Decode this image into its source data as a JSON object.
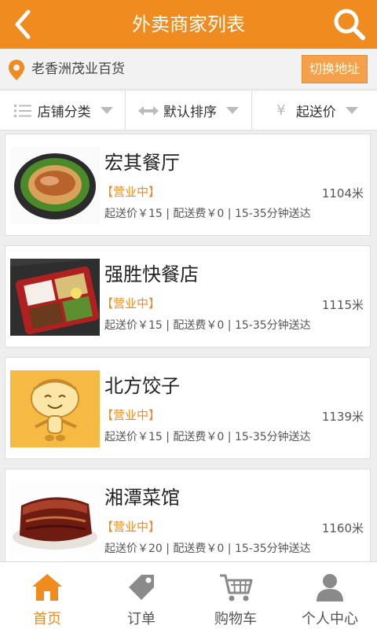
{
  "header": {
    "title": "外卖商家列表"
  },
  "address": {
    "text": "老香洲茂业百货",
    "switch_label": "切换地址"
  },
  "filters": [
    {
      "label": "店铺分类"
    },
    {
      "label": "默认排序"
    },
    {
      "label": "起送价"
    }
  ],
  "shops": [
    {
      "name": "宏其餐厅",
      "status": "【营业中】",
      "distance": "1104米",
      "meta": "起送价￥15 |  配送费￥0 | 15-35分钟送达"
    },
    {
      "name": "强胜快餐店",
      "status": "【营业中】",
      "distance": "1115米",
      "meta": "起送价￥15 |  配送费￥0 | 15-35分钟送达"
    },
    {
      "name": "北方饺子",
      "status": "【营业中】",
      "distance": "1139米",
      "meta": "起送价￥15 |  配送费￥0 | 15-35分钟送达"
    },
    {
      "name": "湘潭菜馆",
      "status": "【营业中】",
      "distance": "1160米",
      "meta": "起送价￥20 |  配送费￥0 | 15-35分钟送达"
    }
  ],
  "tabs": [
    {
      "label": "首页",
      "icon": "home-icon",
      "active": true
    },
    {
      "label": "订单",
      "icon": "tag-icon",
      "active": false
    },
    {
      "label": "购物车",
      "icon": "cart-icon",
      "active": false
    },
    {
      "label": "个人中心",
      "icon": "user-icon",
      "active": false
    }
  ],
  "colors": {
    "accent": "#f08b1f",
    "switch_button": "#f5a04a"
  }
}
